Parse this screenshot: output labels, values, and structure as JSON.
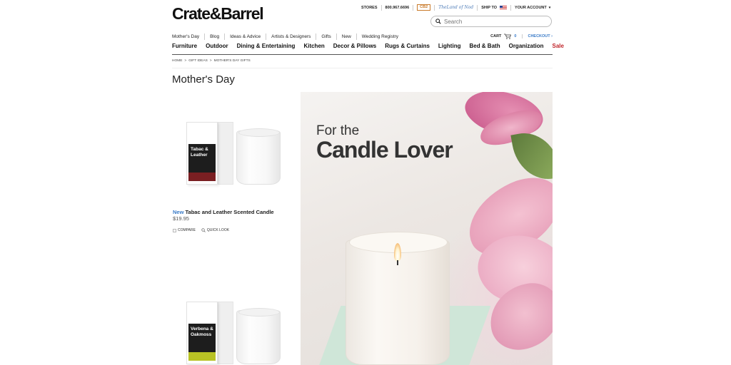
{
  "header": {
    "logo": "Crate&Barrel",
    "util": {
      "stores": "STORES",
      "phone": "800.967.6696",
      "cb2": "CB2",
      "land_of_nod": "TheLand of Nod",
      "ship_to": "SHIP TO",
      "account": "YOUR ACCOUNT"
    },
    "search_placeholder": "Search",
    "subnav": [
      "Mother's Day",
      "Blog",
      "Ideas & Advice",
      "Artists & Designers",
      "Gifts",
      "New",
      "Wedding Registry"
    ],
    "cart": {
      "label": "CART",
      "count": "0",
      "checkout": "CHECKOUT ›"
    },
    "mainnav": [
      "Furniture",
      "Outdoor",
      "Dining & Entertaining",
      "Kitchen",
      "Decor & Pillows",
      "Rugs & Curtains",
      "Lighting",
      "Bed & Bath",
      "Organization",
      "Sale"
    ]
  },
  "breadcrumbs": [
    "HOME",
    ">",
    "GIFT IDEAS",
    ">",
    "MOTHER'S DAY GIFTS"
  ],
  "page_title": "Mother's Day",
  "products": [
    {
      "badge": "New",
      "name": "Tabac and Leather Scented Candle",
      "price": "$19.95",
      "label": "Tabac & Leather",
      "stripe_color": "#7a1f22",
      "compare": "COMPARE",
      "quick_look": "QUICK LOOK"
    },
    {
      "label": "Verbena & Oakmoss",
      "stripe_color": "#b8c224"
    }
  ],
  "hero": {
    "line1": "For the",
    "line2": "Candle Lover"
  },
  "colors": {
    "accent_blue": "#3a7bc8",
    "sale_red": "#c0262b"
  }
}
